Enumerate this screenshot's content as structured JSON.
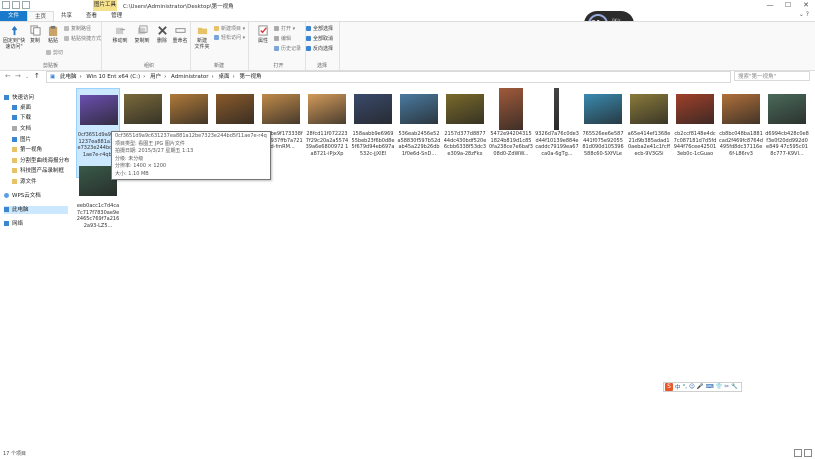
{
  "window": {
    "context_tab": "图片工具",
    "title": "C:\\Users\\Administrator\\Desktop\\第一视角",
    "min": "—",
    "max": "☐",
    "close": "✕"
  },
  "tabs": [
    {
      "label": "文件"
    },
    {
      "label": "主页"
    },
    {
      "label": "共享"
    },
    {
      "label": "查看"
    },
    {
      "label": "管理"
    }
  ],
  "ribbon": {
    "clipboard": {
      "group": "剪贴板",
      "pin": "固定到\"快速访问\"",
      "copy": "复制",
      "paste": "粘贴",
      "copy_path": "复制路径",
      "paste_shortcut": "粘贴快捷方式",
      "cut": "剪切"
    },
    "organize": {
      "group": "组织",
      "move_to": "移动到",
      "copy_to": "复制到",
      "delete": "删除",
      "rename": "重命名"
    },
    "new": {
      "group": "新建",
      "new_folder": "新建\n文件夹",
      "new_item": "新建项目 ▾",
      "easy_access": "轻松访问 ▾"
    },
    "open": {
      "group": "打开",
      "properties": "属性",
      "open": "打开 ▾",
      "edit": "编辑",
      "history": "历史记录"
    },
    "select": {
      "group": "选择",
      "select_all": "全部选择",
      "select_none": "全部取消",
      "invert": "反向选择"
    }
  },
  "address": {
    "path": [
      "此电脑",
      "Win 10 Ent x64 (C:)",
      "用户",
      "Administrator",
      "桌面",
      "第一视角"
    ],
    "search_placeholder": "搜索\"第一视角\""
  },
  "nav": {
    "items": [
      {
        "label": "快速访问"
      },
      {
        "label": "桌面"
      },
      {
        "label": "下载"
      },
      {
        "label": "文档"
      },
      {
        "label": "图片"
      },
      {
        "label": "第一视角"
      },
      {
        "label": "分割型曲线海报分布"
      },
      {
        "label": "科技图产品录制框"
      },
      {
        "label": "源文件"
      },
      {
        "label": "WPS云文档"
      },
      {
        "label": "此电脑"
      },
      {
        "label": "网络"
      }
    ]
  },
  "files": [
    {
      "name": "0cf3651d9a9c631237ea881a12be7323e244bd5f11ae7e-r4qbB",
      "color": "#6a4fb0"
    },
    {
      "name": "",
      "color": "#7a6a3a"
    },
    {
      "name": "",
      "color": "#b07a3a"
    },
    {
      "name": "",
      "color": "#8a5a2a"
    },
    {
      "name": "b5f7be9f173338f7bf7937ffb7a7210d-fmRM...",
      "color": "#c08a4a"
    },
    {
      "name": "28fcd11f0722237f29c20a2a557439a6e6800972 1a8721-iPjxXp",
      "color": "#d29a5a"
    },
    {
      "name": "158aabb9e6969 55beb23f6b0d8e5f679d94eb697a532c-jjXIEl",
      "color": "#3a4a6a"
    },
    {
      "name": "536eab2456e52a58830f597b52dab45a229b26db1f0e6d-SnD...",
      "color": "#4a7aa0"
    },
    {
      "name": "2157d377d887744dc430bdf520e6cbb6338f53dc3e309a-28zFkx",
      "color": "#7a6a2a"
    },
    {
      "name": "5472e942043151824b819d1c850fa238ce7e6baf308d0-ZdWW...",
      "color": "#a05a3a"
    },
    {
      "name": "9326d7a76c0de3d44f10139e884ecaddc79199ea67ca0a-6gTg...",
      "color": "#444444"
    },
    {
      "name": "765526ee6e587441f075e92055 81d090d105396588c60-SXfVLe",
      "color": "#3a8ab0"
    },
    {
      "name": "a65e414ef1368e21d9b385adad10aeba2e41c1fcffecb-9V3G5i",
      "color": "#8a7a3a"
    },
    {
      "name": "cb2ccf8148e4dc7c087181d7d5fd944f76cee425013eb0c-1cGuao",
      "color": "#a0402a"
    },
    {
      "name": "cb8bc048ba1881cad2f469fc8764d495fd8dc37116e6f-L86rv3",
      "color": "#b0703a"
    },
    {
      "name": "d6994cb428c0e8f3e0f20dd992d0e849 47c595c018c777-K9VI...",
      "color": "#4a6a5a"
    },
    {
      "name": "eeb0acc1c7d4ca7c717f7830ae9e2465c769f7a2162a93-LZ5...",
      "color": "#3a5a4a"
    }
  ],
  "tooltip": {
    "line1": "0cf3651d9a9c631237ea881a12be7323e244bd5f11ae7e-r4qbB",
    "line2": "项目类型: 看图王 JPG 图片文件",
    "line3": "拍摄日期: 2015/3/27 星期五 1:13",
    "line4": "分级: 未分级",
    "line5": "分辨率: 1400 × 1200",
    "line6": "大小: 1.10 MB"
  },
  "status": {
    "count": "17 个项目"
  },
  "speed_widget": {
    "value": "31",
    "unit": "%",
    "up": "0K/s",
    "down": "0K/s"
  },
  "ime_bar": {
    "logo": "S",
    "items": [
      "中",
      "°,",
      "☺",
      "🎤",
      "⌨",
      "👕",
      "✂",
      "🔧"
    ]
  }
}
